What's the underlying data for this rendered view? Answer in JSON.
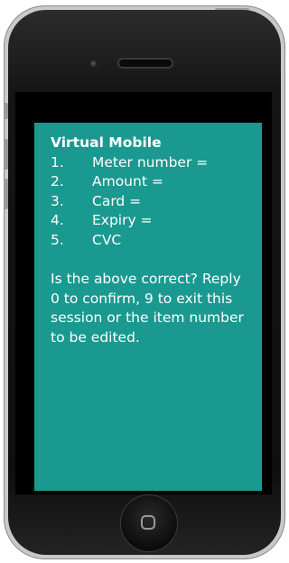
{
  "ussd": {
    "title": "Virtual Mobile",
    "items": [
      {
        "num": "1.",
        "label": "Meter number ="
      },
      {
        "num": "2.",
        "label": "Amount ="
      },
      {
        "num": "3.",
        "label": "Card ="
      },
      {
        "num": "4.",
        "label": "Expiry ="
      },
      {
        "num": "5.",
        "label": "CVC"
      }
    ],
    "prompt": "Is the above correct? Reply 0 to confirm, 9 to exit this session or the item number to be edited."
  },
  "colors": {
    "screen_bg": "#1a9990",
    "text": "#ffffff",
    "bezel": "#111111"
  },
  "icons": {
    "home_button": "rounded-square-icon"
  }
}
